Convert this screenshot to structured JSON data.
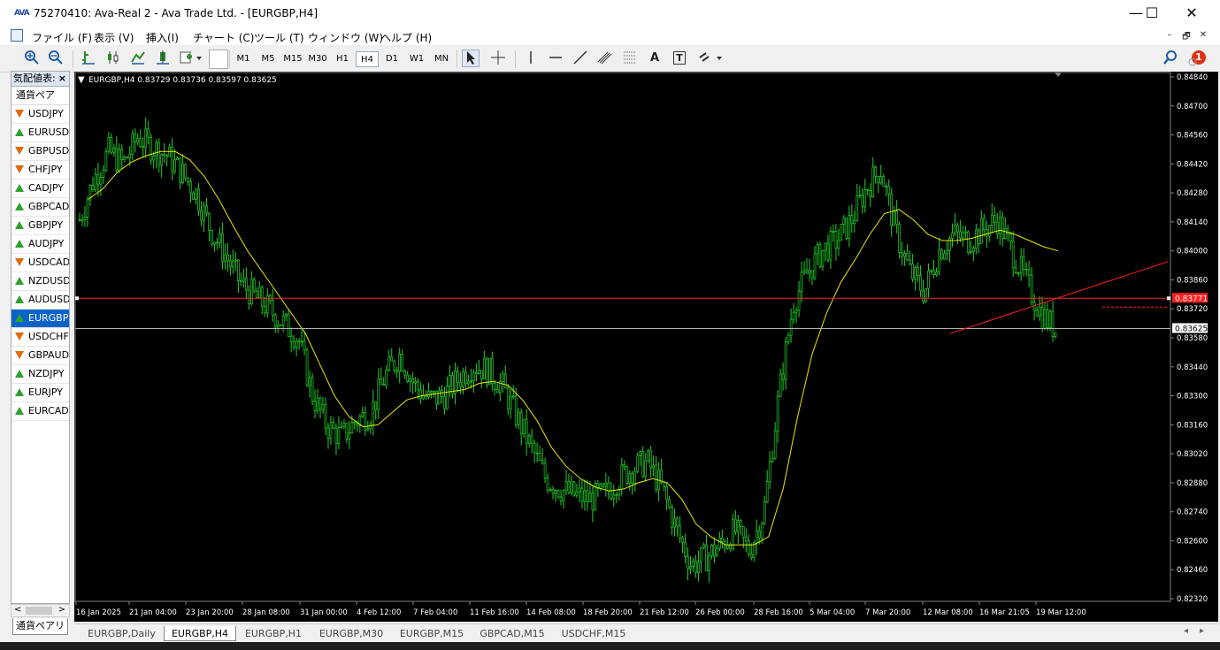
{
  "window": {
    "title": "75270410: Ava-Real 2 - Ava Trade Ltd. - [EURGBP,H4]",
    "app_logo": "AVA",
    "minimize": "—",
    "maximize": "☐",
    "close": "✕"
  },
  "menu": {
    "items": [
      "ファイル (F)",
      "表示 (V)",
      "挿入(I)",
      "チャート (C)",
      "ツール (T)",
      "ウィンドウ (W)",
      "ヘルプ (H)"
    ],
    "mdi_min": "–",
    "mdi_restore": "🗗",
    "mdi_close": "✕"
  },
  "toolbar": {
    "timeframes": [
      "M1",
      "M5",
      "M15",
      "M30",
      "H1",
      "H4",
      "D1",
      "W1",
      "MN"
    ],
    "active_timeframe": "H4",
    "notification_count": "1",
    "text_tool": "A",
    "label_tool": "T"
  },
  "market_watch": {
    "title": "気配値表:",
    "close": "×",
    "column": "通貨ペア",
    "symbols": [
      {
        "name": "USDJPY",
        "dir": "down"
      },
      {
        "name": "EURUSD",
        "dir": "up"
      },
      {
        "name": "GBPUSD",
        "dir": "down"
      },
      {
        "name": "CHFJPY",
        "dir": "down"
      },
      {
        "name": "CADJPY",
        "dir": "up"
      },
      {
        "name": "GBPCAD",
        "dir": "up"
      },
      {
        "name": "GBPJPY",
        "dir": "up"
      },
      {
        "name": "AUDJPY",
        "dir": "up"
      },
      {
        "name": "USDCAD",
        "dir": "down"
      },
      {
        "name": "NZDUSD",
        "dir": "up"
      },
      {
        "name": "AUDUSD",
        "dir": "up"
      },
      {
        "name": "EURGBP",
        "dir": "up",
        "selected": true
      },
      {
        "name": "USDCHF",
        "dir": "down"
      },
      {
        "name": "GBPAUD",
        "dir": "down"
      },
      {
        "name": "NZDJPY",
        "dir": "up"
      },
      {
        "name": "EURJPY",
        "dir": "up"
      },
      {
        "name": "EURCAD",
        "dir": "up"
      }
    ],
    "scroll_left": "<",
    "scroll_right": ">",
    "tab_label": "通貨ペアリ"
  },
  "chart_data": {
    "type": "line",
    "title": "EURGBP,H4  0.83729 0.83736 0.83597 0.83625",
    "header_marker": "▼",
    "y_ticks": [
      "0.84840",
      "0.84700",
      "0.84560",
      "0.84420",
      "0.84280",
      "0.84140",
      "0.84000",
      "0.83860",
      "0.83720",
      "0.83580",
      "0.83440",
      "0.83300",
      "0.83160",
      "0.83020",
      "0.82880",
      "0.82740",
      "0.82600",
      "0.82460",
      "0.82320"
    ],
    "ylim": [
      0.8232,
      0.8484
    ],
    "x_ticks": [
      "16 Jan 2025",
      "21 Jan 04:00",
      "23 Jan 20:00",
      "28 Jan 08:00",
      "31 Jan 00:00",
      "4 Feb 12:00",
      "7 Feb 04:00",
      "11 Feb 16:00",
      "14 Feb 08:00",
      "18 Feb 20:00",
      "21 Feb 12:00",
      "26 Feb 00:00",
      "28 Feb 16:00",
      "5 Mar 04:00",
      "7 Mar 20:00",
      "12 Mar 08:00",
      "16 Mar 21:05",
      "19 Mar 12:00"
    ],
    "close_prices": [
      0.8415,
      0.8435,
      0.8448,
      0.8442,
      0.8455,
      0.845,
      0.8446,
      0.8438,
      0.8428,
      0.841,
      0.8398,
      0.8385,
      0.8378,
      0.8372,
      0.8365,
      0.8358,
      0.833,
      0.8315,
      0.831,
      0.8318,
      0.8322,
      0.834,
      0.835,
      0.8335,
      0.8328,
      0.833,
      0.8338,
      0.8345,
      0.8342,
      0.8335,
      0.832,
      0.8305,
      0.829,
      0.8285,
      0.8282,
      0.828,
      0.8282,
      0.829,
      0.8295,
      0.8298,
      0.8285,
      0.8265,
      0.8248,
      0.8252,
      0.8258,
      0.8265,
      0.8255,
      0.8275,
      0.833,
      0.8375,
      0.839,
      0.84,
      0.8405,
      0.8415,
      0.843,
      0.844,
      0.841,
      0.839,
      0.838,
      0.84,
      0.8408,
      0.8405,
      0.841,
      0.8415,
      0.84,
      0.8385,
      0.837,
      0.8362
    ],
    "ma_prices": [
      0.8425,
      0.843,
      0.8438,
      0.8443,
      0.8446,
      0.8448,
      0.8448,
      0.8444,
      0.8436,
      0.8425,
      0.8412,
      0.84,
      0.839,
      0.838,
      0.837,
      0.836,
      0.8345,
      0.833,
      0.832,
      0.8315,
      0.8316,
      0.8322,
      0.8328,
      0.833,
      0.8331,
      0.8332,
      0.8333,
      0.8336,
      0.8337,
      0.8335,
      0.8328,
      0.8318,
      0.8305,
      0.8296,
      0.829,
      0.8286,
      0.8284,
      0.8285,
      0.8288,
      0.829,
      0.8288,
      0.828,
      0.8268,
      0.8262,
      0.8258,
      0.8258,
      0.8258,
      0.8262,
      0.8285,
      0.832,
      0.835,
      0.837,
      0.8385,
      0.8396,
      0.8408,
      0.8418,
      0.842,
      0.8415,
      0.8408,
      0.8405,
      0.8405,
      0.8406,
      0.8408,
      0.841,
      0.8408,
      0.8405,
      0.8402,
      0.84
    ],
    "hline_price": "0.83771",
    "bid_price": "0.83625",
    "trendline": {
      "x0": 0.8,
      "y0": 0.836,
      "x1": 1.03,
      "y1": 0.84
    },
    "colors": {
      "background": "#000000",
      "candles": "#22d02a",
      "ma": "#e8e800",
      "hline": "#ff2020",
      "trendline": "#ff2020",
      "bidline": "#b0b0b0",
      "text": "#ffffff"
    }
  },
  "chart_tabs": {
    "tabs": [
      "EURGBP,Daily",
      "EURGBP,H4",
      "EURGBP,H1",
      "EURGBP,M30",
      "EURGBP,M15",
      "GBPCAD,M15",
      "USDCHF,M15"
    ],
    "active": "EURGBP,H4",
    "nav_left": "◂",
    "nav_right": "▸"
  }
}
